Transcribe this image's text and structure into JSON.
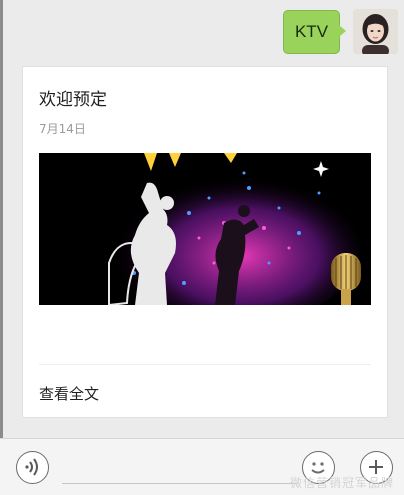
{
  "message": {
    "text": "KTV",
    "avatar_icon": "user-avatar-icon"
  },
  "article": {
    "title": "欢迎预定",
    "date": "7月14日",
    "image": "ktv-dancers-microphone-cover",
    "read_more": "查看全文"
  },
  "input_bar": {
    "voice_icon": "voice-icon",
    "emoji_icon": "emoji-icon",
    "plus_icon": "plus-icon"
  },
  "watermark": "微信营销冠军品牌",
  "colors": {
    "bubble": "#9ad35c",
    "background": "#ebebeb",
    "card": "#ffffff"
  }
}
